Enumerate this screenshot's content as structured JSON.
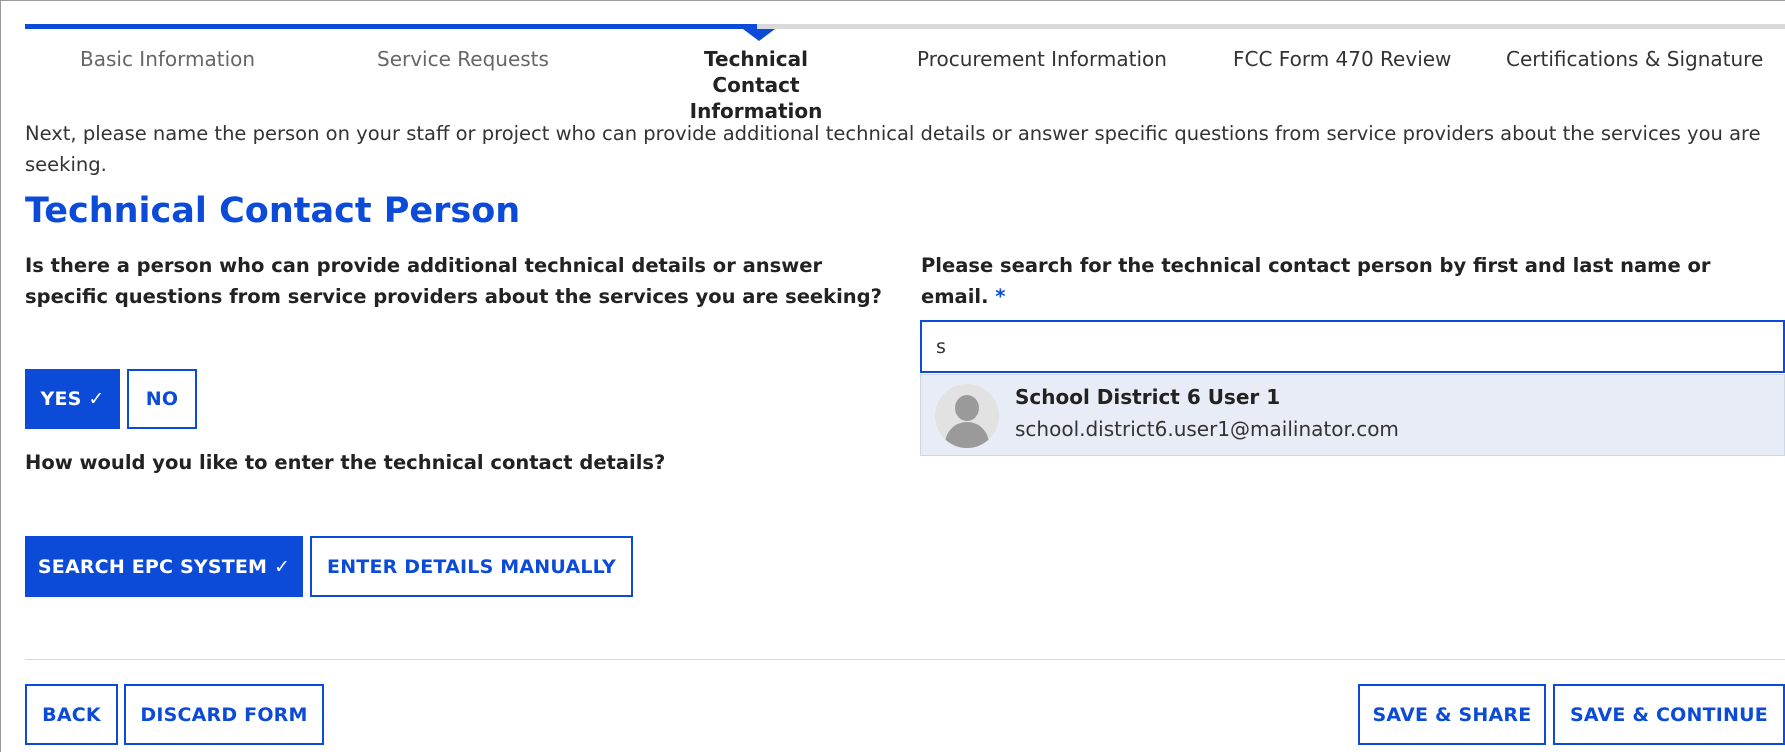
{
  "progress": {
    "steps": [
      {
        "label": "Basic Information",
        "state": "done"
      },
      {
        "label": "Service Requests",
        "state": "done"
      },
      {
        "label": "Technical Contact Information",
        "state": "active"
      },
      {
        "label": "Procurement Information",
        "state": "upcoming"
      },
      {
        "label": "FCC Form 470 Review",
        "state": "upcoming"
      },
      {
        "label": "Certifications & Signature",
        "state": "upcoming"
      }
    ],
    "accent_color": "#0b4bd8"
  },
  "intro": "Next, please name the person on your staff or project who can provide additional technical details or answer specific questions from service providers about the services you are seeking.",
  "section_title": "Technical Contact Person",
  "question_person": {
    "label": "Is there a person who can provide additional technical details or answer specific questions from service providers about the services you are seeking?",
    "yes_label": "YES ✓",
    "no_label": "NO",
    "selected": "YES"
  },
  "question_entry": {
    "label": "How would you like to enter the technical contact details?",
    "search_label": "SEARCH EPC SYSTEM ✓",
    "manual_label": "ENTER DETAILS MANUALLY",
    "selected": "SEARCH EPC SYSTEM"
  },
  "search": {
    "label": "Please search for the technical contact person by first and last name or email.",
    "required_mark": "*",
    "value": "s",
    "suggestions": [
      {
        "name": "School District 6 User 1",
        "email": "school.district6.user1@mailinator.com",
        "icon": "avatar-icon"
      }
    ]
  },
  "footer": {
    "back_label": "BACK",
    "discard_label": "DISCARD FORM",
    "save_share_label": "SAVE & SHARE",
    "save_continue_label": "SAVE & CONTINUE"
  }
}
